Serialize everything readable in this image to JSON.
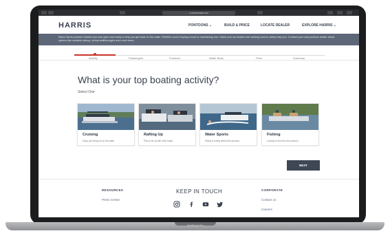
{
  "browser": {
    "url": "● harrisboats.com"
  },
  "header": {
    "logo": "HARRIS",
    "nav": [
      "PONTOONS ⌄",
      "BUILD & PRICE",
      "LOCATE DEALER",
      "EXPLORE HARRIS ⌄"
    ]
  },
  "banner": {
    "text": "Many Harris pontoon Dealers are now open and ready to help you get back on the water. Whether you're buying a boat or maintaining one, Harris and our dealers are working hard to safely help you. Contact your local pontoon dealer about options like curbside pickup, virtual walkthroughs and much more."
  },
  "steps": [
    "Activity",
    "Passengers",
    "Furniture",
    "Water Body",
    "Price",
    "Summary"
  ],
  "quiz": {
    "question": "What is your top boating activity?",
    "instruction": "Select One",
    "options": [
      {
        "title": "Cruising",
        "desc": "Enjoy just being out on the water"
      },
      {
        "title": "Rafting Up",
        "desc": "Plan to tie up with other boats"
      },
      {
        "title": "Water Sports",
        "desc": "Skiing or tubing behind the pontoon"
      },
      {
        "title": "Fishing",
        "desc": "Looking to fish from the pontoon"
      }
    ],
    "next_label": "NEXT"
  },
  "footer": {
    "resources_heading": "RESOURCES",
    "resources_links": [
      "Press Center"
    ],
    "keep_in_touch": "KEEP IN TOUCH",
    "corporate_heading": "CORPORATE",
    "corporate_links": [
      "Contact us",
      "Careers"
    ],
    "social_icons": [
      "instagram-icon",
      "facebook-icon",
      "youtube-icon",
      "twitter-icon"
    ]
  },
  "device": {
    "label": "MacBook Pro"
  },
  "colors": {
    "accent": "#c8332a",
    "banner_bg": "#5d6778",
    "heading": "#3a4150",
    "button_bg": "#3f4654"
  }
}
